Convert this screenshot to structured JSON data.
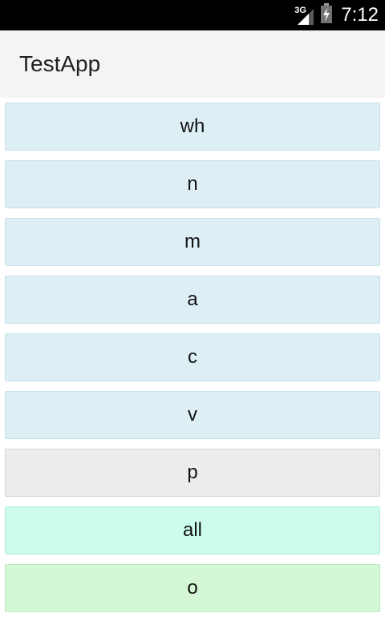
{
  "status_bar": {
    "network": "3G",
    "time": "7:12",
    "icons": [
      "signal-icon",
      "battery-icon"
    ]
  },
  "action_bar": {
    "title": "TestApp"
  },
  "list": {
    "items": [
      {
        "label": "wh",
        "bg": "#ddeef5",
        "border": "#c9e2ec"
      },
      {
        "label": "n",
        "bg": "#ddeef5",
        "border": "#c9e2ec"
      },
      {
        "label": "m",
        "bg": "#ddeef5",
        "border": "#c9e2ec"
      },
      {
        "label": "a",
        "bg": "#ddeef5",
        "border": "#c9e2ec"
      },
      {
        "label": "c",
        "bg": "#ddeef5",
        "border": "#c9e2ec"
      },
      {
        "label": "v",
        "bg": "#ddeef5",
        "border": "#c9e2ec"
      },
      {
        "label": "p",
        "bg": "#ececec",
        "border": "#d6d6d6"
      },
      {
        "label": "all",
        "bg": "#ccfdec",
        "border": "#b5ecd8"
      },
      {
        "label": "o",
        "bg": "#d4f7d6",
        "border": "#bde8c0"
      }
    ]
  }
}
